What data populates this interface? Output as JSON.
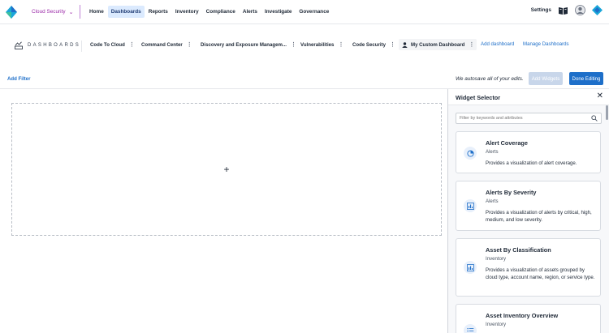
{
  "topnav": {
    "product": "Cloud Security",
    "links": [
      "Home",
      "Dashboards",
      "Reports",
      "Inventory",
      "Compliance",
      "Alerts",
      "Investigate",
      "Governance"
    ],
    "active_link": "Dashboards",
    "settings": "Settings"
  },
  "dashbar": {
    "brand": "DASHBOARDS",
    "tabs": [
      "Code To Cloud",
      "Command Center",
      "Discovery and Exposure Managem...",
      "Vulnerabilities",
      "Code Security",
      "My Custom Dashboard"
    ],
    "add_dashboard": "Add dashboard",
    "manage_dashboards": "Manage Dashboards"
  },
  "filterbar": {
    "add_filter": "Add Filter",
    "autosave_note": "We autosave all of your edits.",
    "add_widgets": "Add Widgets",
    "done_editing": "Done Editing"
  },
  "widget_selector": {
    "title": "Widget Selector",
    "search_placeholder": "Filter by keywords and attributes",
    "widgets": [
      {
        "title": "Alert Coverage",
        "category": "Alerts",
        "description": "Provides a visualization of alert coverage.",
        "icon": "pie-chart-icon"
      },
      {
        "title": "Alerts By Severity",
        "category": "Alerts",
        "description": "Provides a visualization of alerts by critical, high, medium, and low severity.",
        "icon": "bar-chart-icon"
      },
      {
        "title": "Asset By Classification",
        "category": "Inventory",
        "description": "Provides a visualization of assets grouped by cloud type, account name, region, or service type.",
        "icon": "bar-chart-icon"
      },
      {
        "title": "Asset Inventory Overview",
        "category": "Inventory",
        "description": "",
        "icon": "list-icon"
      }
    ]
  },
  "colors": {
    "accent": "#1e6fc9",
    "product": "#9b2aa8",
    "active_tab_bg": "#dbeafe",
    "disabled_button": "#c8d6ea"
  }
}
